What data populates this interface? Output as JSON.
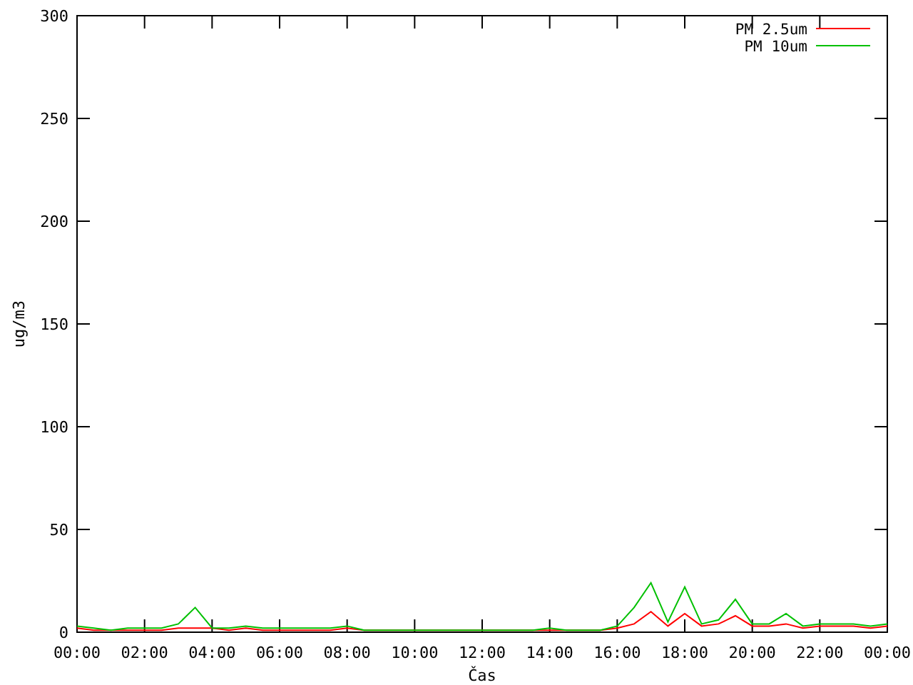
{
  "chart_data": {
    "type": "line",
    "xlabel": "Čas",
    "ylabel": "ug/m3",
    "x": [
      0,
      0.5,
      1,
      1.5,
      2,
      2.5,
      3,
      3.5,
      4,
      4.5,
      5,
      5.5,
      6,
      6.5,
      7,
      7.5,
      8,
      8.5,
      9,
      9.5,
      10,
      10.5,
      11,
      11.5,
      12,
      12.5,
      13,
      13.5,
      14,
      14.5,
      15,
      15.5,
      16,
      16.5,
      17,
      17.5,
      18,
      18.5,
      19,
      19.5,
      20,
      20.5,
      21,
      21.5,
      22,
      22.5,
      23,
      23.5,
      24
    ],
    "series": [
      {
        "name": "PM 2.5um",
        "color": "#ff0000",
        "values": [
          2,
          1,
          1,
          1,
          1,
          1,
          2,
          2,
          2,
          1,
          2,
          1,
          1,
          1,
          1,
          1,
          2,
          1,
          1,
          1,
          1,
          1,
          1,
          1,
          1,
          1,
          1,
          1,
          1,
          1,
          1,
          1,
          2,
          4,
          10,
          3,
          9,
          3,
          4,
          8,
          3,
          3,
          4,
          2,
          3,
          3,
          3,
          2,
          3
        ]
      },
      {
        "name": "PM 10um",
        "color": "#00c000",
        "values": [
          3,
          2,
          1,
          2,
          2,
          2,
          4,
          12,
          2,
          2,
          3,
          2,
          2,
          2,
          2,
          2,
          3,
          1,
          1,
          1,
          1,
          1,
          1,
          1,
          1,
          1,
          1,
          1,
          2,
          1,
          1,
          1,
          3,
          12,
          24,
          5,
          22,
          4,
          6,
          16,
          4,
          4,
          9,
          3,
          4,
          4,
          4,
          3,
          4
        ]
      }
    ],
    "legend": true,
    "xlim": [
      0,
      24
    ],
    "ylim": [
      0,
      300
    ],
    "xticks": [
      {
        "value": 0,
        "label": "00:00"
      },
      {
        "value": 2,
        "label": "02:00"
      },
      {
        "value": 4,
        "label": "04:00"
      },
      {
        "value": 6,
        "label": "06:00"
      },
      {
        "value": 8,
        "label": "08:00"
      },
      {
        "value": 10,
        "label": "10:00"
      },
      {
        "value": 12,
        "label": "12:00"
      },
      {
        "value": 14,
        "label": "14:00"
      },
      {
        "value": 16,
        "label": "16:00"
      },
      {
        "value": 18,
        "label": "18:00"
      },
      {
        "value": 20,
        "label": "20:00"
      },
      {
        "value": 22,
        "label": "22:00"
      },
      {
        "value": 24,
        "label": "00:00"
      }
    ],
    "yticks": [
      0,
      50,
      100,
      150,
      200,
      250,
      300
    ]
  }
}
